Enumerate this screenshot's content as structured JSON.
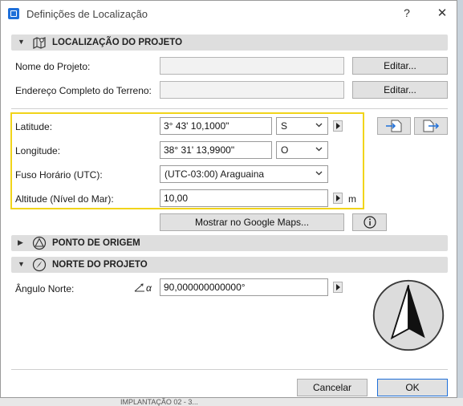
{
  "window": {
    "title": "Definições de Localização",
    "help_label": "?",
    "close_label": "✕"
  },
  "sections": {
    "project_location": "LOCALIZAÇÃO DO PROJETO",
    "origin_point": "PONTO DE ORIGEM",
    "project_north": "NORTE DO PROJETO"
  },
  "project": {
    "name_label": "Nome do Projeto:",
    "name_value": "",
    "address_label": "Endereço Completo do Terreno:",
    "address_value": "",
    "edit_label": "Editar..."
  },
  "geo": {
    "latitude_label": "Latitude:",
    "latitude_value": "3° 43' 10,1000\"",
    "latitude_hemisphere": "S",
    "longitude_label": "Longitude:",
    "longitude_value": "38° 31' 13,9900\"",
    "longitude_hemisphere": "O",
    "timezone_label": "Fuso Horário (UTC):",
    "timezone_value": "(UTC-03:00) Araguaina",
    "altitude_label": "Altitude (Nível do Mar):",
    "altitude_value": "10,00",
    "altitude_unit": "m",
    "google_maps_label": "Mostrar no Google Maps..."
  },
  "north": {
    "angle_label": "Ângulo Norte:",
    "angle_symbol": "α",
    "angle_value": "90,000000000000°"
  },
  "footer": {
    "cancel_label": "Cancelar",
    "ok_label": "OK"
  },
  "colors": {
    "highlight": "#f1d41a",
    "accent": "#1e6fd9"
  },
  "background": {
    "partial_text": "IMPLANTAÇÃO 02 - 3..."
  }
}
